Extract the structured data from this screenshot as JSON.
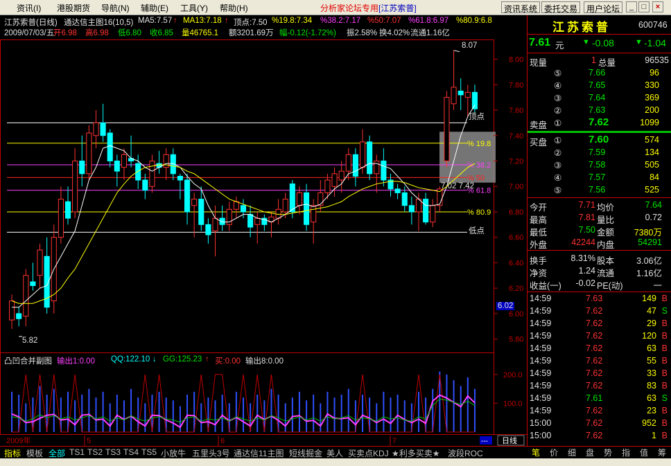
{
  "menu": {
    "items": [
      "资讯(I)",
      "港股期货",
      "导航(N)",
      "辅助(E)",
      "工具(Y)",
      "帮助(H)"
    ],
    "title": "分析家论坛专用",
    "title_stock": "[江苏索普]",
    "right_buttons": [
      "资讯系统",
      "委托交易",
      "用户论坛"
    ],
    "win_min": "_",
    "win_max": "□",
    "win_close": "×"
  },
  "header": {
    "name": "江苏索普(日线)",
    "indicator": "通达信主图16(10,5)",
    "ma5": "MA5:7.57",
    "ma13": "MA13:7.18",
    "top": "顶点:7.50",
    "p198": "%19.8:7.34",
    "p382": "%38.2:7.17",
    "p50": "%50:7.07",
    "p618": "%61.8:6.97",
    "p809": "%80.9:6.8",
    "date": "2009/07/03/五",
    "open": "开6.98",
    "high": "高6.98",
    "low": "低6.80",
    "close": "收6.85",
    "vol": "量46765.1",
    "amount": "额3201.69万",
    "change": "幅-0.12(-1.72%)",
    "amplitude": "振2.58%",
    "turnover": "换4.02%",
    "float": "流通1.16亿"
  },
  "chart_data": [
    {
      "type": "candlestick",
      "title": "江苏索普(日线)",
      "ylim": [
        5.7,
        8.15
      ],
      "yticks": [
        "8.00",
        "7.80",
        "7.60",
        "7.40",
        "7.20",
        "7.00",
        "6.80",
        "6.60",
        "6.40",
        "6.20",
        "6.00",
        "5.80"
      ],
      "xlabels": [
        "2009年",
        "5",
        "6",
        "7"
      ],
      "annotations": {
        "high": "8.07",
        "low": "5.82",
        "mid": "7.02 7.42",
        "top_label": "顶点",
        "bottom_label": "低点",
        "cursor_price": "6.02"
      },
      "levels": [
        {
          "name": "顶点",
          "value": 7.5
        },
        {
          "name": "% 19.8",
          "value": 7.34
        },
        {
          "name": "% 38.2",
          "value": 7.17
        },
        {
          "name": "% 50",
          "value": 7.07
        },
        {
          "name": "% 61.8",
          "value": 6.97
        },
        {
          "name": "% 80.9",
          "value": 6.8
        },
        {
          "name": "低点",
          "value": 6.64
        }
      ],
      "ohlc": [
        [
          5.95,
          6.15,
          5.88,
          6.1
        ],
        [
          6.0,
          6.05,
          5.9,
          5.96
        ],
        [
          5.98,
          6.35,
          5.9,
          6.3
        ],
        [
          6.25,
          6.4,
          6.18,
          6.22
        ],
        [
          6.3,
          6.55,
          6.2,
          6.5
        ],
        [
          6.45,
          6.6,
          6.0,
          6.05
        ],
        [
          6.1,
          6.7,
          6.0,
          6.6
        ],
        [
          6.6,
          7.0,
          6.55,
          6.9
        ],
        [
          6.88,
          7.0,
          6.7,
          6.75
        ],
        [
          6.8,
          7.3,
          6.75,
          7.2
        ],
        [
          7.2,
          7.4,
          7.0,
          7.1
        ],
        [
          7.1,
          7.48,
          7.05,
          7.42
        ],
        [
          7.4,
          7.6,
          7.3,
          7.5
        ],
        [
          7.5,
          7.65,
          7.35,
          7.4
        ],
        [
          7.42,
          7.45,
          7.15,
          7.2
        ],
        [
          7.2,
          7.25,
          7.0,
          7.12
        ],
        [
          7.15,
          7.3,
          7.05,
          7.25
        ],
        [
          7.22,
          7.4,
          7.15,
          7.2
        ],
        [
          7.18,
          7.25,
          6.98,
          7.05
        ],
        [
          7.05,
          7.1,
          6.9,
          6.97
        ],
        [
          7.0,
          7.25,
          6.95,
          7.2
        ],
        [
          7.18,
          7.28,
          7.1,
          7.15
        ],
        [
          7.15,
          7.3,
          7.05,
          7.25
        ],
        [
          7.25,
          7.3,
          7.05,
          7.1
        ],
        [
          7.08,
          7.1,
          6.9,
          7.05
        ],
        [
          7.05,
          7.1,
          6.7,
          6.8
        ],
        [
          6.85,
          6.95,
          6.6,
          6.9
        ],
        [
          6.9,
          7.0,
          6.65,
          6.7
        ],
        [
          6.7,
          6.75,
          6.55,
          6.62
        ],
        [
          6.65,
          6.85,
          6.45,
          6.75
        ],
        [
          6.75,
          6.85,
          6.65,
          6.7
        ],
        [
          6.7,
          6.88,
          6.65,
          6.82
        ],
        [
          6.82,
          6.92,
          6.75,
          6.88
        ],
        [
          6.85,
          6.9,
          6.75,
          6.8
        ],
        [
          6.78,
          6.85,
          6.6,
          6.68
        ],
        [
          6.7,
          6.8,
          6.55,
          6.75
        ],
        [
          6.75,
          6.78,
          6.65,
          6.7
        ],
        [
          6.72,
          6.8,
          6.6,
          6.76
        ],
        [
          6.75,
          6.9,
          6.7,
          6.82
        ],
        [
          6.8,
          6.95,
          6.75,
          6.9
        ],
        [
          7.02,
          7.05,
          6.75,
          6.8
        ],
        [
          6.85,
          7.0,
          6.78,
          6.95
        ],
        [
          6.95,
          7.02,
          6.65,
          6.7
        ],
        [
          6.72,
          6.9,
          6.55,
          6.85
        ],
        [
          6.85,
          7.05,
          6.8,
          6.95
        ],
        [
          6.95,
          7.1,
          6.9,
          7.05
        ],
        [
          7.0,
          7.15,
          6.92,
          7.1
        ],
        [
          7.05,
          7.2,
          6.95,
          7.12
        ],
        [
          7.12,
          7.3,
          7.05,
          7.25
        ],
        [
          7.25,
          7.3,
          7.0,
          7.08
        ],
        [
          7.15,
          7.45,
          7.1,
          7.35
        ],
        [
          7.35,
          7.4,
          7.05,
          7.1
        ],
        [
          7.1,
          7.25,
          6.95,
          7.2
        ],
        [
          7.2,
          7.3,
          7.0,
          7.05
        ],
        [
          7.05,
          7.1,
          6.92,
          6.98
        ],
        [
          6.98,
          7.02,
          6.9,
          6.95
        ],
        [
          6.95,
          7.0,
          6.8,
          6.85
        ],
        [
          6.85,
          6.92,
          6.7,
          6.8
        ],
        [
          6.8,
          6.95,
          6.65,
          6.9
        ],
        [
          6.9,
          6.95,
          6.7,
          6.72
        ],
        [
          6.72,
          6.9,
          6.68,
          6.85
        ],
        [
          6.85,
          7.0,
          6.8,
          6.98
        ],
        [
          7.2,
          7.75,
          7.15,
          7.7
        ],
        [
          7.65,
          8.07,
          7.6,
          7.78
        ],
        [
          7.75,
          7.85,
          7.6,
          7.72
        ],
        [
          7.7,
          7.8,
          7.55,
          7.74
        ],
        [
          7.74,
          7.8,
          7.58,
          7.61
        ]
      ],
      "ma5": [
        6.05,
        6.05,
        6.1,
        6.15,
        6.2,
        6.22,
        6.35,
        6.45,
        6.55,
        6.65,
        6.85,
        7.05,
        7.15,
        7.3,
        7.32,
        7.3,
        7.28,
        7.22,
        7.2,
        7.15,
        7.12,
        7.15,
        7.18,
        7.18,
        7.15,
        7.08,
        7.02,
        6.98,
        6.85,
        6.75,
        6.72,
        6.72,
        6.75,
        6.78,
        6.78,
        6.75,
        6.74,
        6.72,
        6.75,
        6.78,
        6.82,
        6.85,
        6.86,
        6.84,
        6.86,
        6.92,
        6.98,
        7.02,
        7.1,
        7.12,
        7.15,
        7.18,
        7.18,
        7.16,
        7.14,
        7.08,
        7.02,
        6.95,
        6.9,
        6.85,
        6.85,
        6.86,
        7.0,
        7.2,
        7.4,
        7.55,
        7.64
      ],
      "ma13": [
        6.1,
        6.08,
        6.08,
        6.08,
        6.1,
        6.12,
        6.15,
        6.2,
        6.28,
        6.35,
        6.45,
        6.55,
        6.65,
        6.75,
        6.85,
        6.95,
        7.02,
        7.08,
        7.12,
        7.15,
        7.16,
        7.17,
        7.17,
        7.16,
        7.15,
        7.12,
        7.1,
        7.06,
        7.02,
        6.98,
        6.94,
        6.9,
        6.88,
        6.86,
        6.84,
        6.82,
        6.8,
        6.79,
        6.78,
        6.78,
        6.79,
        6.8,
        6.81,
        6.82,
        6.83,
        6.84,
        6.86,
        6.88,
        6.92,
        6.95,
        6.98,
        7.0,
        7.02,
        7.03,
        7.04,
        7.04,
        7.03,
        7.01,
        6.99,
        6.98,
        6.97,
        6.96,
        7.0,
        7.05,
        7.1,
        7.15,
        7.18
      ]
    },
    {
      "type": "bar+line",
      "title": "凸凹合并副图",
      "ylim": [
        0,
        250
      ],
      "yticks": [
        "200.0",
        "100.0"
      ],
      "legend": [
        "输出1:0.00",
        "QQ:122.10",
        "GG:125.23",
        "买:0.00",
        "输出8:0.00"
      ],
      "bars": [
        140,
        130,
        100,
        120,
        160,
        130,
        150,
        120,
        140,
        110,
        130,
        150,
        120,
        140,
        100,
        130,
        110,
        150,
        120,
        100,
        130,
        140,
        120,
        110,
        90,
        130,
        140,
        100,
        120,
        110,
        130,
        100,
        140,
        120,
        100,
        130,
        110,
        150,
        130,
        100,
        120,
        140,
        110,
        130,
        100,
        140,
        120,
        130,
        150,
        110,
        130,
        120,
        100,
        140,
        120,
        130,
        110,
        100,
        140,
        120,
        150,
        210,
        200,
        180,
        160,
        190,
        150
      ]
    }
  ],
  "quote": {
    "name": "江苏索普",
    "code": "600746",
    "price": "7.61",
    "price_unit": "元",
    "change_arrow": "▼",
    "change": "-0.08",
    "change_arrow2": "▼",
    "change_pct": "-1.04",
    "now_label": "现量",
    "now_val": "1",
    "total_label": "总量",
    "total_val": "96535",
    "sell_label": "卖盘",
    "buy_label": "买盘",
    "asks": [
      {
        "lvl": "⑤",
        "price": "7.66",
        "vol": "96"
      },
      {
        "lvl": "④",
        "price": "7.65",
        "vol": "330"
      },
      {
        "lvl": "③",
        "price": "7.64",
        "vol": "369"
      },
      {
        "lvl": "②",
        "price": "7.63",
        "vol": "200"
      },
      {
        "lvl": "①",
        "price": "7.62",
        "vol": "1099"
      }
    ],
    "bids": [
      {
        "lvl": "①",
        "price": "7.60",
        "vol": "574"
      },
      {
        "lvl": "②",
        "price": "7.59",
        "vol": "134"
      },
      {
        "lvl": "③",
        "price": "7.58",
        "vol": "505"
      },
      {
        "lvl": "④",
        "price": "7.57",
        "vol": "84"
      },
      {
        "lvl": "⑤",
        "price": "7.56",
        "vol": "525"
      }
    ],
    "stats": [
      {
        "l1": "今开",
        "v1": "7.71",
        "l2": "均价",
        "v2": "7.64"
      },
      {
        "l1": "最高",
        "v1": "7.81",
        "l2": "量比",
        "v2": "0.72"
      },
      {
        "l1": "最低",
        "v1": "7.50",
        "l2": "金额",
        "v2": "7380万"
      },
      {
        "l1": "外盘",
        "v1": "42244",
        "l2": "内盘",
        "v2": "54291"
      }
    ],
    "stats2": [
      {
        "l1": "换手",
        "v1": "8.31%",
        "l2": "股本",
        "v2": "3.06亿"
      },
      {
        "l1": "净资",
        "v1": "1.24",
        "l2": "流通",
        "v2": "1.16亿"
      },
      {
        "l1": "收益(一)",
        "v1": "-0.02",
        "l2": "PE(动)",
        "v2": "一"
      }
    ],
    "ticks": [
      {
        "t": "14:59",
        "p": "7.63",
        "v": "149",
        "bs": "B"
      },
      {
        "t": "14:59",
        "p": "7.62",
        "v": "47",
        "bs": "S"
      },
      {
        "t": "14:59",
        "p": "7.62",
        "v": "29",
        "bs": "B"
      },
      {
        "t": "14:59",
        "p": "7.62",
        "v": "120",
        "bs": "B"
      },
      {
        "t": "14:59",
        "p": "7.62",
        "v": "63",
        "bs": "B"
      },
      {
        "t": "14:59",
        "p": "7.62",
        "v": "55",
        "bs": "B"
      },
      {
        "t": "14:59",
        "p": "7.62",
        "v": "33",
        "bs": "B"
      },
      {
        "t": "14:59",
        "p": "7.62",
        "v": "83",
        "bs": "B"
      },
      {
        "t": "14:59",
        "p": "7.61",
        "v": "63",
        "bs": "S"
      },
      {
        "t": "14:59",
        "p": "7.62",
        "v": "23",
        "bs": "B"
      },
      {
        "t": "15:00",
        "p": "7.62",
        "v": "952",
        "bs": "B"
      },
      {
        "t": "15:00",
        "p": "7.62",
        "v": "1",
        "bs": "B"
      }
    ]
  },
  "bottom_tabs": [
    "指标",
    "模板",
    "全部",
    "TS1",
    "TS2",
    "TS3",
    "TS4",
    "TS5",
    "小放牛",
    "五里头3号",
    "通达信11主图",
    "短线掘金",
    "美人",
    "买卖点KDJ",
    "★利多买卖★",
    "波段ROC"
  ],
  "right_tabs": [
    "笔",
    "价",
    "细",
    "盘",
    "势",
    "指",
    "值",
    "筹"
  ],
  "period": "日线",
  "dash": "---"
}
